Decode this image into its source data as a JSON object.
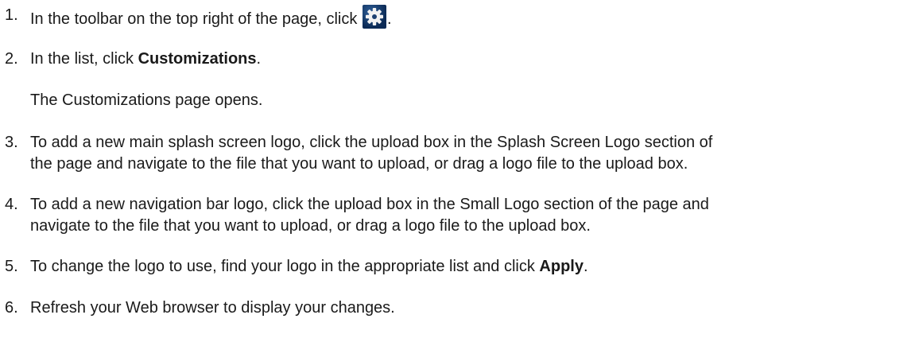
{
  "steps": [
    {
      "num": "1.",
      "before": "In the toolbar on the top right of the page, click ",
      "icon": "gear-icon",
      "after": "."
    },
    {
      "num": "2.",
      "before": "In the list, click ",
      "bold": "Customizations",
      "after": "."
    },
    {
      "note": "The Customizations page opens."
    },
    {
      "num": "3.",
      "line1": "To add a new main splash screen logo, click the upload box in the Splash Screen Logo section of",
      "line2": "the page and navigate to the file that you want to upload, or drag a logo file to the upload box."
    },
    {
      "num": "4.",
      "line1": "To add a new navigation bar logo, click the upload box in the Small Logo section of the page and",
      "line2": "navigate to the file that you want to upload, or drag a logo file to the upload box."
    },
    {
      "num": "5.",
      "before": "To change the logo to use, find your logo in the appropriate list and click ",
      "bold": "Apply",
      "after": "."
    },
    {
      "num": "6.",
      "text": "Refresh your Web browser to display your changes."
    }
  ],
  "colors": {
    "text": "#1a1a1a",
    "icon_bg": "#0b2a55",
    "icon_gear": "#f2f2f2"
  }
}
